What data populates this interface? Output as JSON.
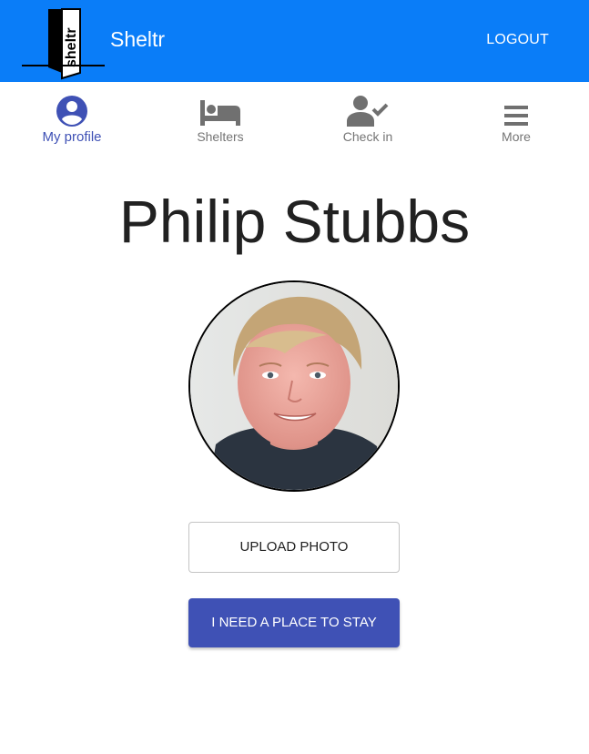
{
  "app": {
    "title": "Sheltr",
    "logo_text": "sheltr",
    "logout_label": "LOGOUT",
    "brand_color": "#0a7df8"
  },
  "nav": {
    "items": [
      {
        "label": "My profile",
        "icon": "account-circle-icon",
        "active": true
      },
      {
        "label": "Shelters",
        "icon": "bed-icon",
        "active": false
      },
      {
        "label": "Check in",
        "icon": "person-check-icon",
        "active": false
      },
      {
        "label": "More",
        "icon": "menu-icon",
        "active": false
      }
    ],
    "active_color": "#3f51b5"
  },
  "profile": {
    "name": "Philip Stubbs",
    "avatar": "profile-photo"
  },
  "actions": {
    "upload_label": "UPLOAD PHOTO",
    "need_place_label": "I NEED A PLACE TO STAY",
    "primary_color": "#3f51b5"
  }
}
